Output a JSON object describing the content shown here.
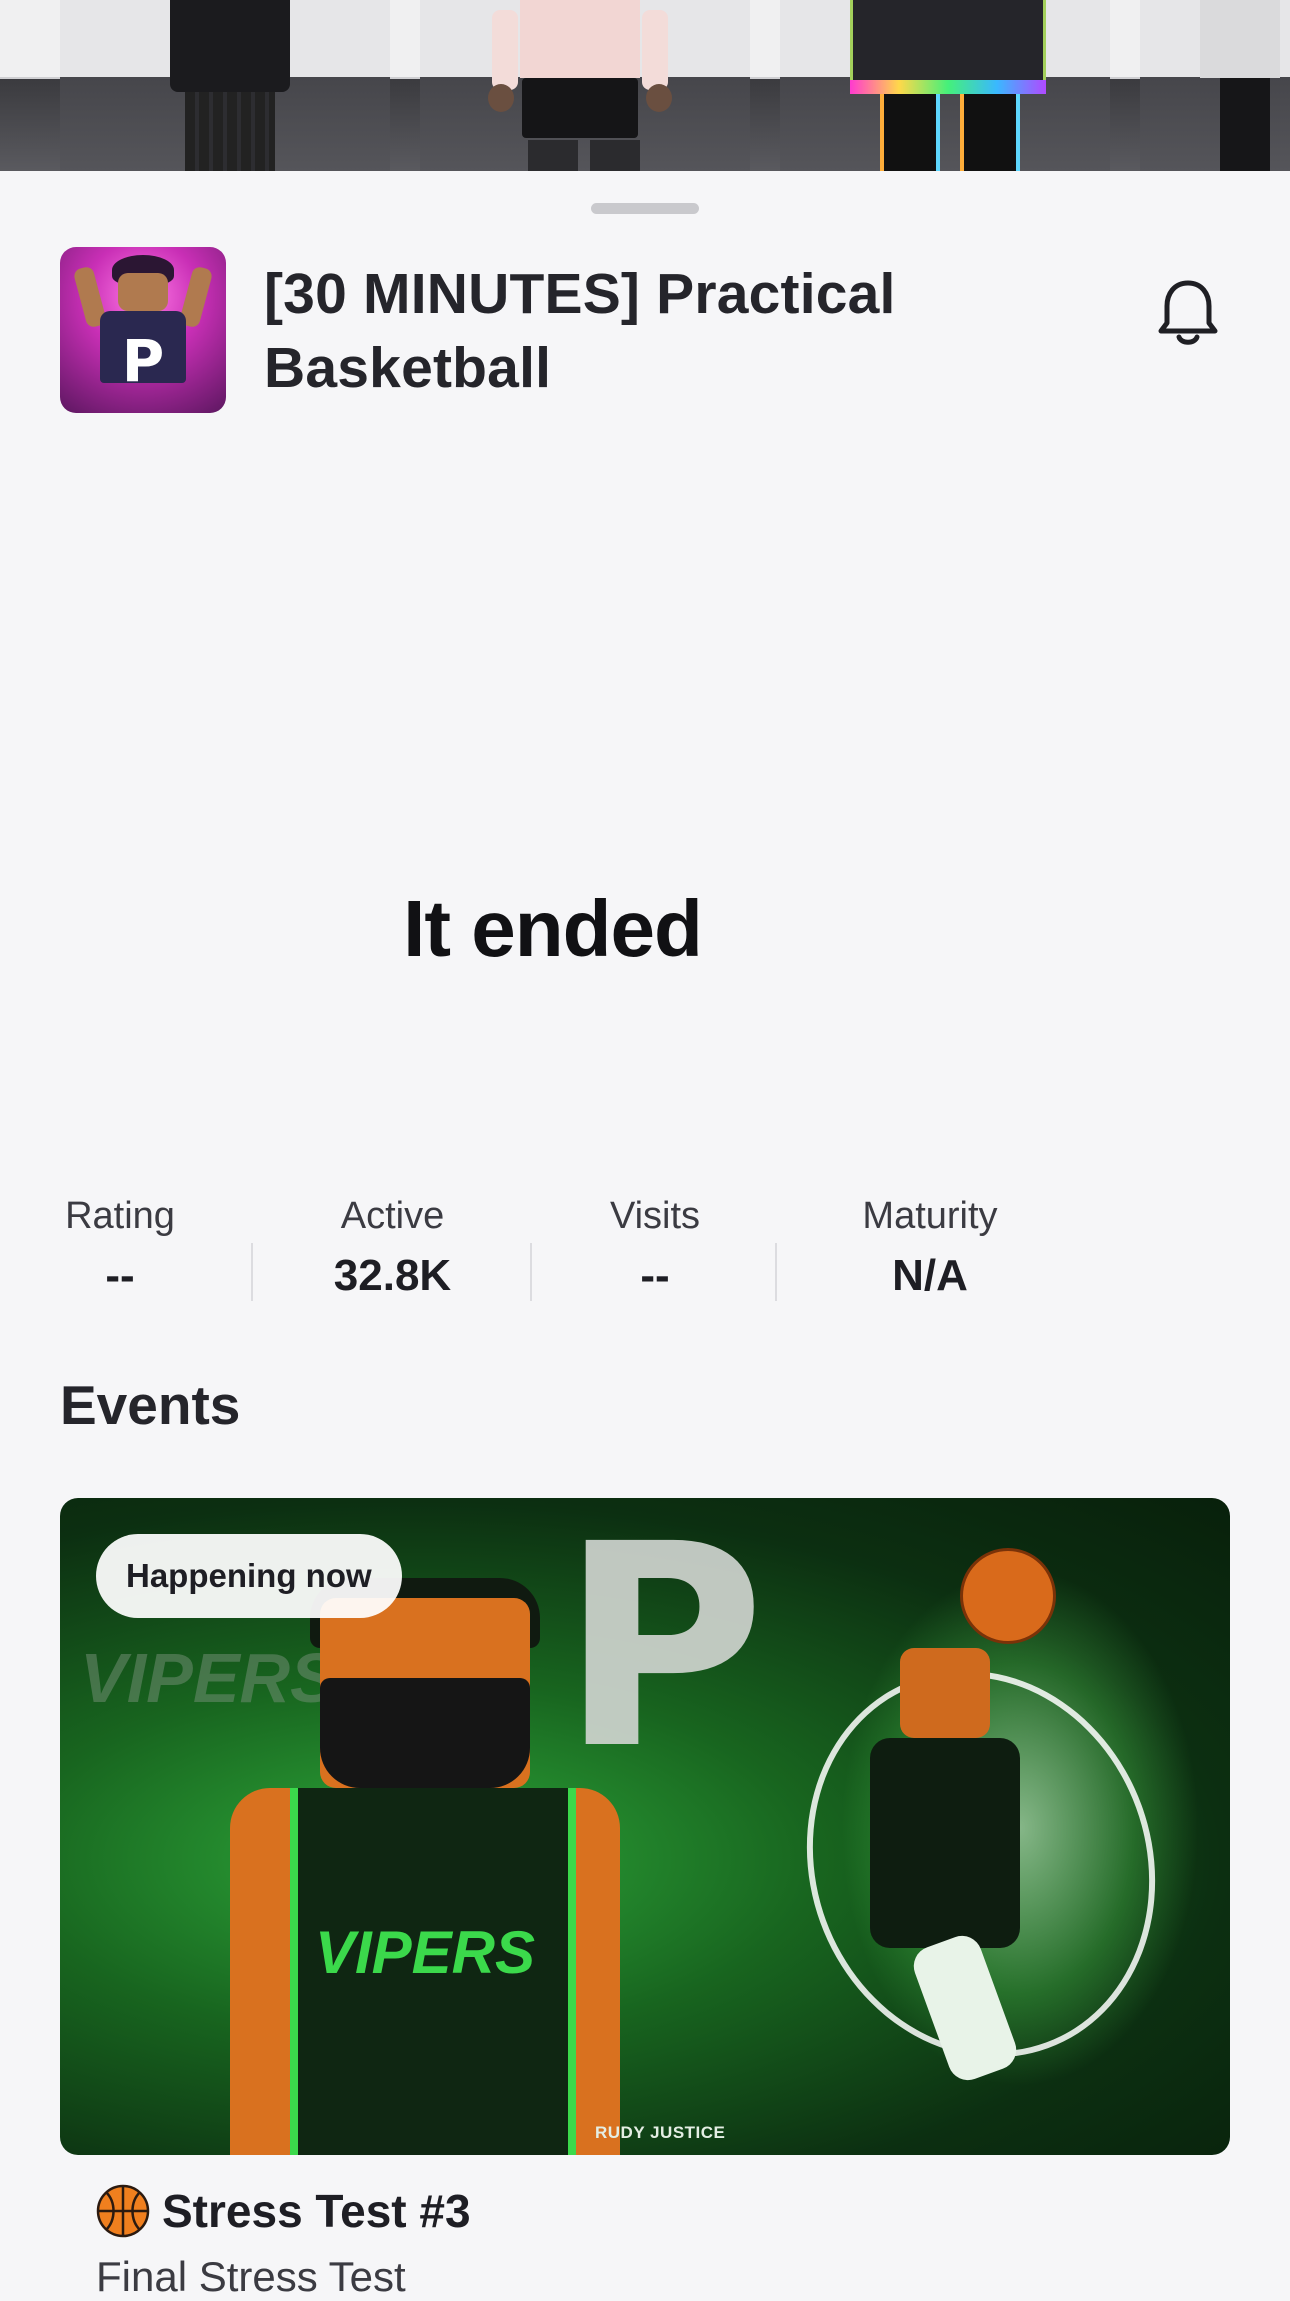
{
  "game": {
    "title": "[30 MINUTES] Practical Basketball",
    "status_message": "It ended"
  },
  "stats": [
    {
      "label": "Rating",
      "value": "--"
    },
    {
      "label": "Active",
      "value": "32.8K"
    },
    {
      "label": "Visits",
      "value": "--"
    },
    {
      "label": "Maturity",
      "value": "N/A"
    }
  ],
  "events": {
    "heading": "Events",
    "items": [
      {
        "badge": "Happening now",
        "title": "Stress Test #3",
        "subtitle": "Final Stress Test",
        "image_credit": "RUDY JUSTICE",
        "image_team_text": "VIPERS"
      }
    ]
  },
  "icons": {
    "notify": "bell-icon",
    "event_emoji": "basketball-icon"
  },
  "colors": {
    "background": "#f6f6f8",
    "text_primary": "#1d1d22",
    "event_green": "#3bd94b"
  }
}
